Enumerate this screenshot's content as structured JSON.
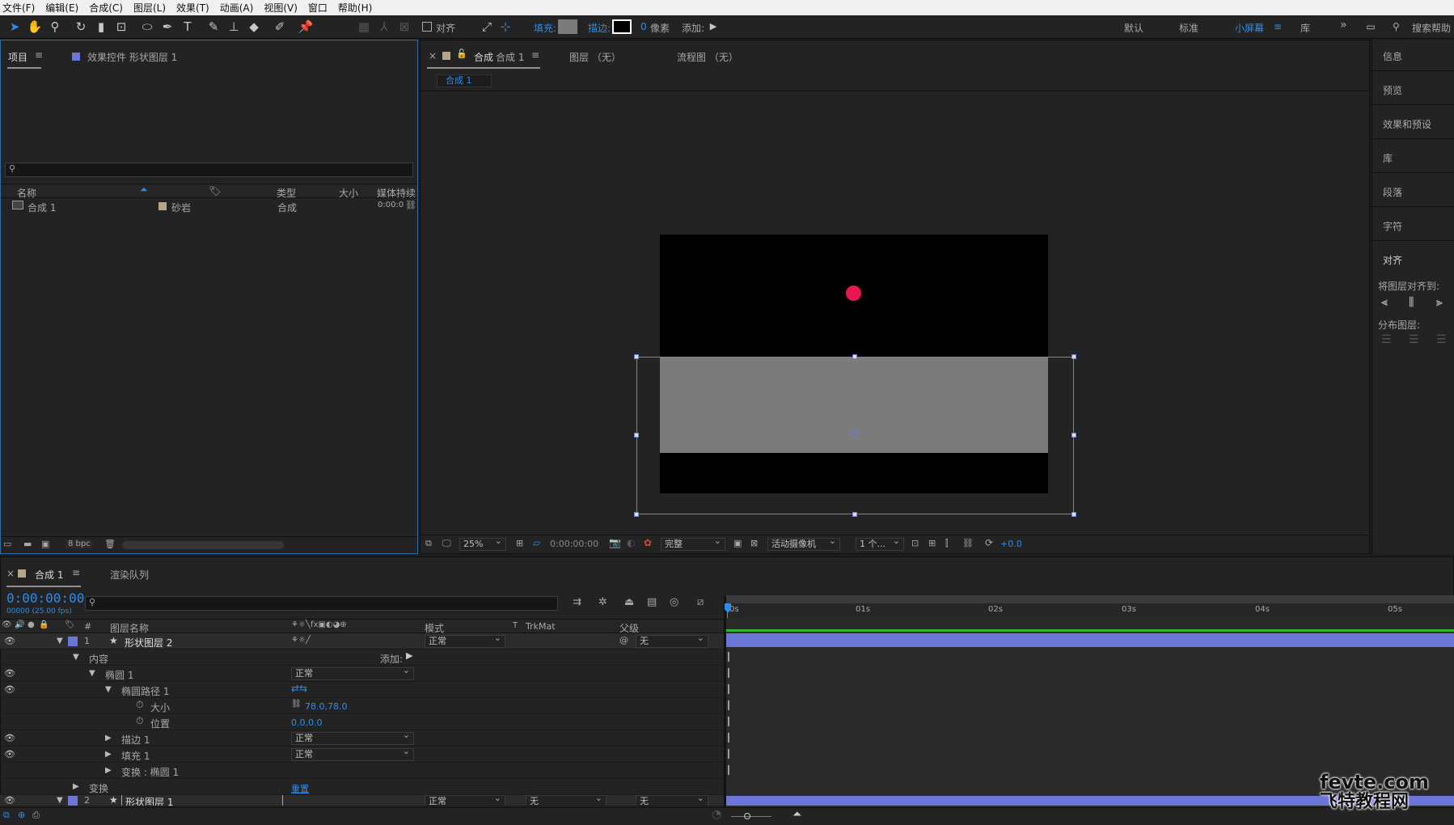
{
  "menu": [
    "文件(F)",
    "编辑(E)",
    "合成(C)",
    "图层(L)",
    "效果(T)",
    "动画(A)",
    "视图(V)",
    "窗口",
    "帮助(H)"
  ],
  "toolbar": {
    "snap_label": "对齐",
    "fill_label": "填充:",
    "stroke_label": "描边:",
    "stroke_width": "0",
    "stroke_unit": "像素",
    "add_label": "添加:",
    "workspaces": [
      "默认",
      "标准",
      "小屏幕",
      "库"
    ],
    "search_help": "搜索帮助",
    "fill_color": "#7b7b7b",
    "accent": "#2d8ceb"
  },
  "project_panel": {
    "tab_project": "项目",
    "tab_effects": "效果控件 形状图层 1",
    "columns": [
      "名称",
      "类型",
      "大小",
      "媒体持续"
    ],
    "items": [
      {
        "name": "合成 1",
        "label": "砂岩",
        "type": "合成",
        "duration": "0:00:0"
      }
    ],
    "bpc": "8 bpc"
  },
  "comp_panel": {
    "tab_comp_prefix": "合成",
    "tab_comp_name": "合成 1",
    "tab_layer": "图层 （无）",
    "tab_flow": "流程图 （无）",
    "breadcrumb": "合成 1",
    "zoom": "25%",
    "timecode": "0:00:00:00",
    "resolution": "完整",
    "camera": "活动摄像机",
    "views": "1 个...",
    "exposure": "+0.0",
    "dot_color": "#e8174f",
    "bg_color": "#000000",
    "shape_color": "#7b7b7b"
  },
  "right_rail": {
    "items": [
      "信息",
      "预览",
      "效果和预设",
      "库",
      "段落",
      "字符",
      "对齐"
    ],
    "align_to_label": "将图层对齐到:",
    "distribute_label": "分布图层:"
  },
  "timeline": {
    "tab_comp": "合成 1",
    "tab_render": "渲染队列",
    "timecode": "0:00:00:00",
    "fps": "00000 (25.00 fps)",
    "col_name": "图层名称",
    "col_mode": "模式",
    "col_t": "T",
    "col_trkmat": "TrkMat",
    "col_parent": "父级",
    "ruler": [
      "0s",
      "01s",
      "02s",
      "03s",
      "04s",
      "05s"
    ],
    "rows": [
      {
        "num": "1",
        "name": "形状图层 2",
        "mode": "正常",
        "parent": "无"
      },
      {
        "name": "内容",
        "add": "添加:"
      },
      {
        "name": "椭圆 1",
        "mode": "正常"
      },
      {
        "name": "椭圆路径 1"
      },
      {
        "name": "大小",
        "value": "78.0,78.0"
      },
      {
        "name": "位置",
        "value": "0.0,0.0"
      },
      {
        "name": "描边 1",
        "mode": "正常"
      },
      {
        "name": "填充 1",
        "mode": "正常"
      },
      {
        "name": "变换 : 椭圆 1"
      },
      {
        "name": "变换",
        "reset": "重置"
      },
      {
        "num": "2",
        "name": "形状图层 1",
        "mode": "正常",
        "trkmat": "无",
        "parent": "无"
      }
    ],
    "layer_color": "#6b76d6"
  },
  "watermark": {
    "line1": "fevte.com",
    "line2": "飞特教程网"
  }
}
